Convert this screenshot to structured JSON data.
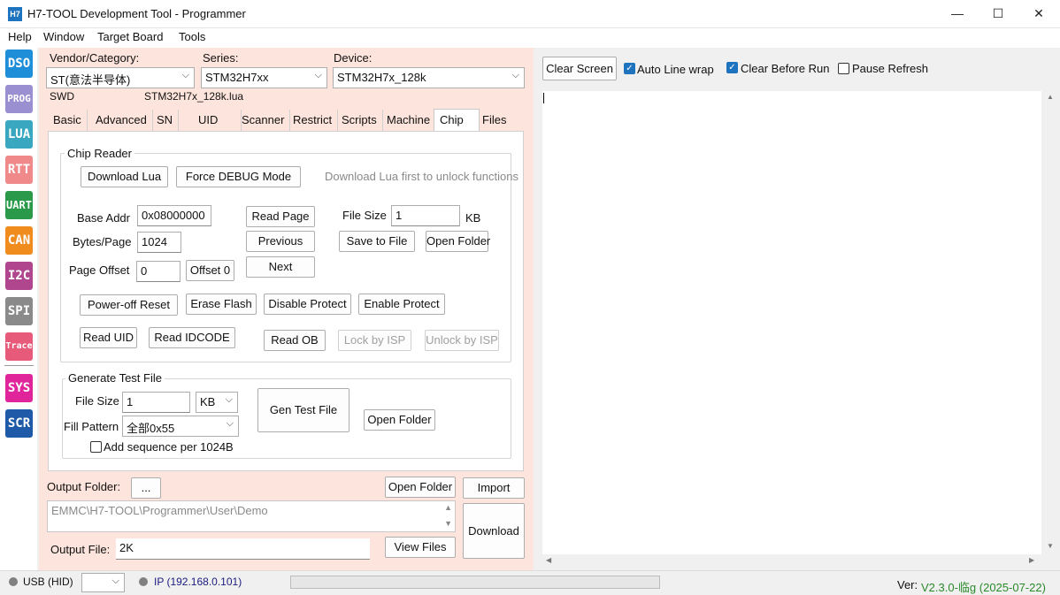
{
  "window": {
    "app_icon_text": "H7",
    "title": "H7-TOOL Development Tool - Programmer",
    "minimize": "—",
    "maximize": "☐",
    "close": "✕"
  },
  "menu": [
    "Help",
    "Window",
    "Target Board",
    "Tools"
  ],
  "sidebar": [
    {
      "label": "DSO",
      "color": "#1e8ed8"
    },
    {
      "label": "PROG",
      "color": "#9a8fd0"
    },
    {
      "label": "LUA",
      "color": "#3aa7c0"
    },
    {
      "label": "RTT",
      "color": "#f08a8a"
    },
    {
      "label": "UART",
      "color": "#2a9a4a"
    },
    {
      "label": "CAN",
      "color": "#f08c1e"
    },
    {
      "label": "I2C",
      "color": "#b0478e"
    },
    {
      "label": "SPI",
      "color": "#8a8a8a"
    },
    {
      "label": "Trace",
      "color": "#e85a7a"
    },
    {
      "label": "SYS",
      "color": "#e0249a"
    },
    {
      "label": "SCR",
      "color": "#1e5aa8"
    }
  ],
  "selector": {
    "vendor_label": "Vendor/Category:",
    "vendor_value": "ST(意法半导体)",
    "series_label": "Series:",
    "series_value": "STM32H7xx",
    "device_label": "Device:",
    "device_value": "STM32H7x_128k",
    "interface": "SWD",
    "lua_file": "STM32H7x_128k.lua"
  },
  "tabs": [
    "Basic",
    "Advanced",
    "SN",
    "UID",
    "Scanner",
    "Restrict",
    "Scripts",
    "Machine",
    "Chip",
    "Files"
  ],
  "active_tab": "Chip",
  "chip_reader": {
    "title": "Chip Reader",
    "download_lua": "Download Lua",
    "force_debug": "Force DEBUG Mode",
    "hint": "Download Lua first to unlock functions",
    "base_addr_label": "Base Addr",
    "base_addr_value": "0x08000000",
    "bytes_page_label": "Bytes/Page",
    "bytes_page_value": "1024",
    "page_offset_label": "Page Offset",
    "page_offset_value": "0",
    "offset0": "Offset 0",
    "read_page": "Read Page",
    "previous": "Previous",
    "next": "Next",
    "file_size_label": "File Size",
    "file_size_value": "1",
    "file_size_unit": "KB",
    "save_to_file": "Save to File",
    "open_folder": "Open Folder",
    "power_off_reset": "Power-off Reset",
    "erase_flash": "Erase Flash",
    "disable_protect": "Disable Protect",
    "enable_protect": "Enable Protect",
    "read_uid": "Read UID",
    "read_idcode": "Read IDCODE",
    "read_ob": "Read OB",
    "lock_isp": "Lock by ISP",
    "unlock_isp": "Unlock by ISP"
  },
  "gen_test": {
    "title": "Generate Test File",
    "file_size_label": "File Size",
    "file_size_value": "1",
    "unit": "KB",
    "fill_label": "Fill Pattern",
    "fill_value": "全部0x55",
    "gen_button": "Gen Test File",
    "open_folder": "Open Folder",
    "add_seq": "Add sequence per 1024B"
  },
  "output": {
    "folder_label": "Output Folder:",
    "browse": "...",
    "open_folder": "Open Folder",
    "import": "Import",
    "path": "EMMC\\H7-TOOL\\Programmer\\User\\Demo",
    "download": "Download",
    "file_label": "Output File:",
    "file_value": "2K",
    "view_files": "View Files"
  },
  "right": {
    "clear_screen": "Clear Screen",
    "auto_wrap": "Auto Line wrap",
    "auto_wrap_checked": true,
    "clear_before_run": "Clear Before Run",
    "clear_before_run_checked": true,
    "pause_refresh": "Pause Refresh",
    "pause_refresh_checked": false
  },
  "status": {
    "usb": "USB (HID)",
    "ip": "IP (192.168.0.101)",
    "ver_label": "Ver:",
    "ver_value": "V2.3.0-临g (2025-07-22)"
  }
}
